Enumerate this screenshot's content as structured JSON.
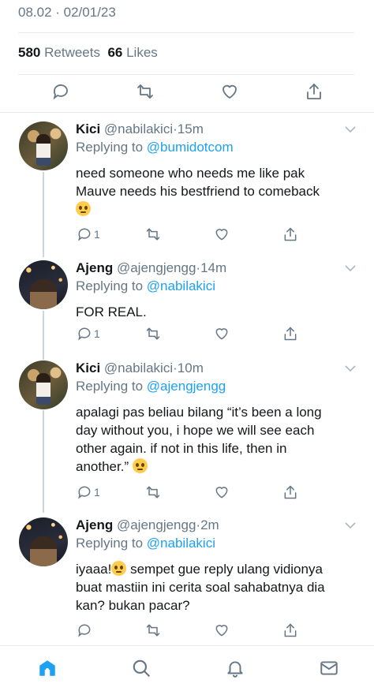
{
  "top": {
    "timestamp": "08.02 · 02/01/23",
    "retweets_count": "580",
    "retweets_label": "Retweets",
    "likes_count": "66",
    "likes_label": "Likes"
  },
  "main_actions": [
    "reply-icon",
    "retweet-icon",
    "like-icon",
    "share-icon"
  ],
  "tweets": [
    {
      "name": "Kici",
      "handle": "@nabilakici",
      "dot": "·",
      "age": "15m",
      "replying_prefix": "Replying to",
      "replying_to": "@bumidotcom",
      "text": "need someone who needs me like pak\nMauve needs his bestfriend to comeback",
      "reply_count": "1"
    },
    {
      "name": "Ajeng",
      "handle": "@ajengjengg",
      "dot": "·",
      "age": "14m",
      "replying_prefix": "Replying to",
      "replying_to": "@nabilakici",
      "text": "FOR REAL.",
      "reply_count": "1"
    },
    {
      "name": "Kici",
      "handle": "@nabilakici",
      "dot": "·",
      "age": "10m",
      "replying_prefix": "Replying to",
      "replying_to": "@ajengjengg",
      "text": "apalagi pas beliau bilang “it’s been a long\nday without you, i hope we will see each\nother again. if not in this life, then in\nanother.”",
      "reply_count": "1"
    },
    {
      "name": "Ajeng",
      "handle": "@ajengjengg",
      "dot": "·",
      "age": "2m",
      "replying_prefix": "Replying to",
      "replying_to": "@nabilakici",
      "text_part1": "iyaaa!",
      "text_part2": " sempet gue reply ulang vidionya\nbuat mastiin ini cerita soal sahabatnya dia\nkan? bukan pacar?"
    }
  ],
  "bottom_nav": [
    "home-icon",
    "search-icon",
    "notifications-icon",
    "messages-icon"
  ],
  "colors": {
    "accent": "#1da1f2",
    "muted": "#657786",
    "text": "#14171a",
    "divider": "#e6ecf0"
  }
}
